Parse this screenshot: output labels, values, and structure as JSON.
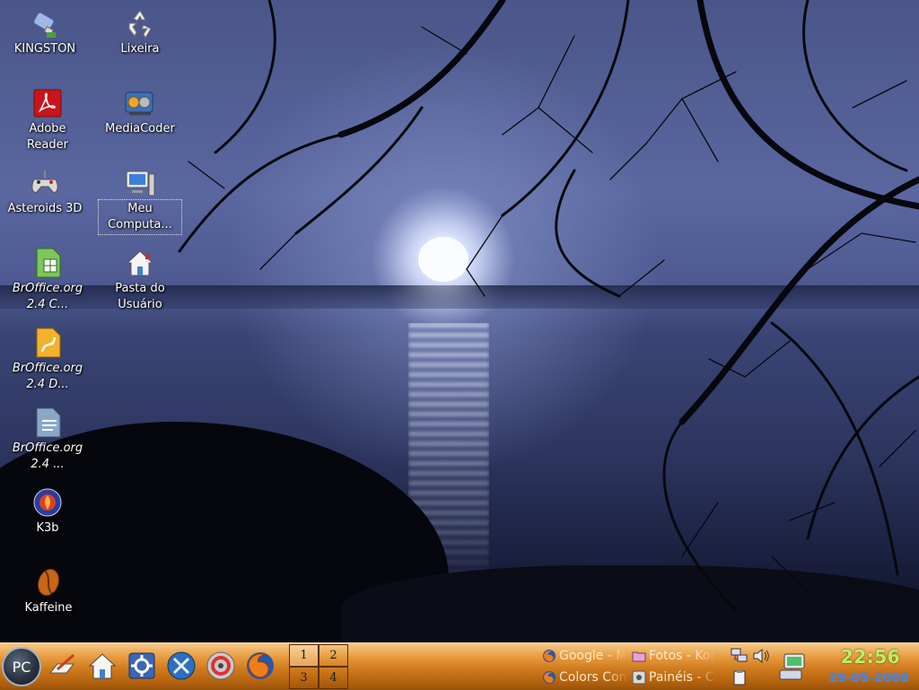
{
  "desktop_icons": [
    {
      "label": "KINGSTON",
      "icon": "usb-drive-icon"
    },
    {
      "label": "Lixeira",
      "icon": "recycle-bin-icon"
    },
    {
      "label": "Adobe Reader",
      "icon": "adobe-reader-icon"
    },
    {
      "label": "MediaCoder",
      "icon": "mediacoder-icon"
    },
    {
      "label": "Asteroids 3D",
      "icon": "gamepad-icon"
    },
    {
      "label": "Meu Computa...",
      "icon": "computer-icon"
    },
    {
      "label": "BrOffice.org 2.4 C...",
      "icon": "spreadsheet-icon"
    },
    {
      "label": "Pasta do Usuário",
      "icon": "home-folder-icon"
    },
    {
      "label": "BrOffice.org 2.4 D...",
      "icon": "drawing-icon"
    },
    {
      "label": "BrOffice.org 2.4 ...",
      "icon": "writer-icon"
    },
    {
      "label": "K3b",
      "icon": "k3b-icon"
    },
    {
      "label": "Kaffeine",
      "icon": "kaffeine-icon"
    }
  ],
  "taskbar": {
    "start_label": "PC",
    "quick_launch": [
      "editor-icon",
      "home-icon",
      "control-center-icon",
      "system-tools-icon",
      "disc-burner-icon",
      "firefox-icon"
    ],
    "pager": [
      "1",
      "2",
      "3",
      "4"
    ],
    "active_desktop": "1",
    "tasks": [
      {
        "label": "Google - Mozilla Firefox",
        "icon": "firefox-icon"
      },
      {
        "label": "Fotos - Konqueror",
        "icon": "folder-icon"
      },
      {
        "label": "Colors Com",
        "icon": "firefox-icon"
      },
      {
        "label": "Painéis - Configurações",
        "icon": "settings-icon"
      }
    ],
    "tray": [
      "network-icon",
      "volume-icon",
      "klipper-icon",
      "computer-tray-icon"
    ],
    "clock_time": "22:56",
    "clock_date": "29-05-2008"
  },
  "colors": {
    "taskbar": "#d8862b",
    "clock_time": "#b7f06a",
    "clock_date": "#3a86ff"
  }
}
